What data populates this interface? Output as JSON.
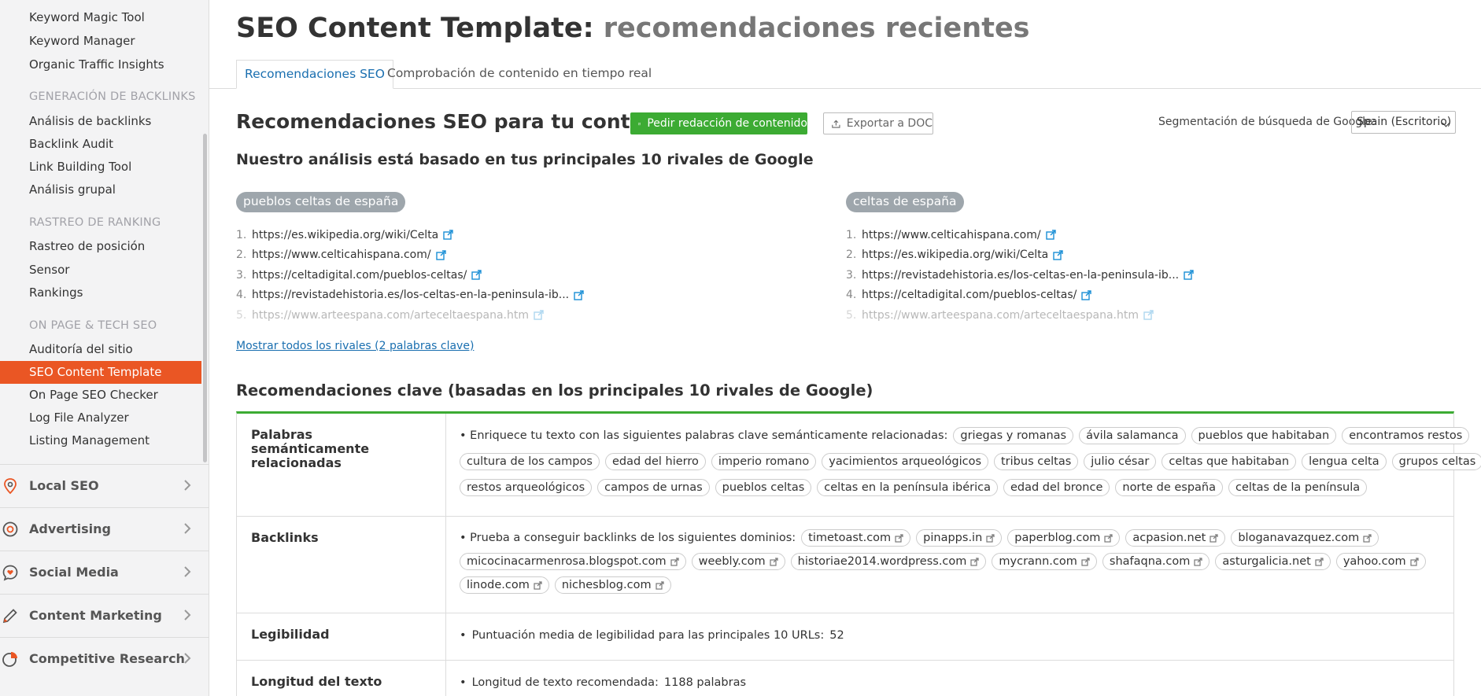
{
  "sidebar": {
    "items_top": [
      "Keyword Magic Tool",
      "Keyword Manager",
      "Organic Traffic Insights"
    ],
    "section_backlinks": "GENERACIÓN DE BACKLINKS",
    "items_backlinks": [
      "Análisis de backlinks",
      "Backlink Audit",
      "Link Building Tool",
      "Análisis grupal"
    ],
    "section_ranking": "RASTREO DE RANKING",
    "items_ranking": [
      "Rastreo de posición",
      "Sensor",
      "Rankings"
    ],
    "section_onpage": "ON PAGE & TECH SEO",
    "items_onpage": [
      "Auditoría del sitio",
      "SEO Content Template",
      "On Page SEO Checker",
      "Log File Analyzer",
      "Listing Management"
    ],
    "groups": [
      {
        "label": "Local SEO",
        "icon": "location-pin-icon"
      },
      {
        "label": "Advertising",
        "icon": "target-icon"
      },
      {
        "label": "Social Media",
        "icon": "speech-heart-icon"
      },
      {
        "label": "Content Marketing",
        "icon": "pencil-icon"
      },
      {
        "label": "Competitive Research",
        "icon": "pie-chart-icon"
      }
    ]
  },
  "header": {
    "title": "SEO Content Template:",
    "title_sub": "recomendaciones recientes",
    "tabs": [
      "Recomendaciones SEO",
      "Comprobación de contenido en tiempo real"
    ]
  },
  "toolbar": {
    "heading": "Recomendaciones SEO para tu contenido",
    "request_button": "Pedir redacción de contenido",
    "export_button": "Exportar a DOC",
    "segment_label": "Segmentación de búsqueda de Google:",
    "segment_value": "Spain (Escritorio)"
  },
  "analysis_heading": "Nuestro análisis está basado en tus principales 10 rivales de Google",
  "rivals": [
    {
      "keyword": "pueblos celtas de españa",
      "urls": [
        "https://es.wikipedia.org/wiki/Celta",
        "https://www.celticahispana.com/",
        "https://celtadigital.com/pueblos-celtas/",
        "https://revistadehistoria.es/los-celtas-en-la-peninsula-ib...",
        "https://www.arteespana.com/arteceltaespana.htm"
      ]
    },
    {
      "keyword": "celtas de españa",
      "urls": [
        "https://www.celticahispana.com/",
        "https://es.wikipedia.org/wiki/Celta",
        "https://revistadehistoria.es/los-celtas-en-la-peninsula-ib...",
        "https://celtadigital.com/pueblos-celtas/",
        "https://www.arteespana.com/arteceltaespana.htm"
      ]
    }
  ],
  "show_all_link": "Mostrar todos los rivales (2 palabras clave)",
  "key_recs_heading": "Recomendaciones clave (basadas en los principales 10 rivales de Google)",
  "recs": {
    "semantic": {
      "label": "Palabras semánticamente relacionadas",
      "intro": "Enriquece tu texto con las siguientes palabras clave semánticamente relacionadas:",
      "line1": [
        "griegas y romanas",
        "ávila salamanca",
        "pueblos que habitaban",
        "encontramos restos"
      ],
      "line2": [
        "cultura de los campos",
        "edad del hierro",
        "imperio romano",
        "yacimientos arqueológicos",
        "tribus celtas",
        "julio césar",
        "celtas que habitaban",
        "lengua celta",
        "grupos celtas"
      ],
      "line3": [
        "restos arqueológicos",
        "campos de urnas",
        "pueblos celtas",
        "celtas en la península ibérica",
        "edad del bronce",
        "norte de españa",
        "celtas de la península"
      ]
    },
    "backlinks": {
      "label": "Backlinks",
      "intro": "Prueba a conseguir backlinks de los siguientes dominios:",
      "line1": [
        "timetoast.com",
        "pinapps.in",
        "paperblog.com",
        "acpasion.net",
        "bloganavazquez.com"
      ],
      "line2": [
        "micocinacarmenrosa.blogspot.com",
        "weebly.com",
        "historiae2014.wordpress.com",
        "mycrann.com",
        "shafaqna.com",
        "asturgalicia.net",
        "yahoo.com"
      ],
      "line3": [
        "linode.com",
        "nichesblog.com"
      ]
    },
    "readability": {
      "label": "Legibilidad",
      "text": "Puntuación media de legibilidad para las principales 10 URLs:",
      "value": "52"
    },
    "length": {
      "label": "Longitud del texto",
      "text": "Longitud de texto recomendada:",
      "value": "1188 palabras"
    }
  },
  "colors": {
    "accent_orange": "#ea5624",
    "green": "#3cab33",
    "link_blue": "#1a6fb0"
  }
}
